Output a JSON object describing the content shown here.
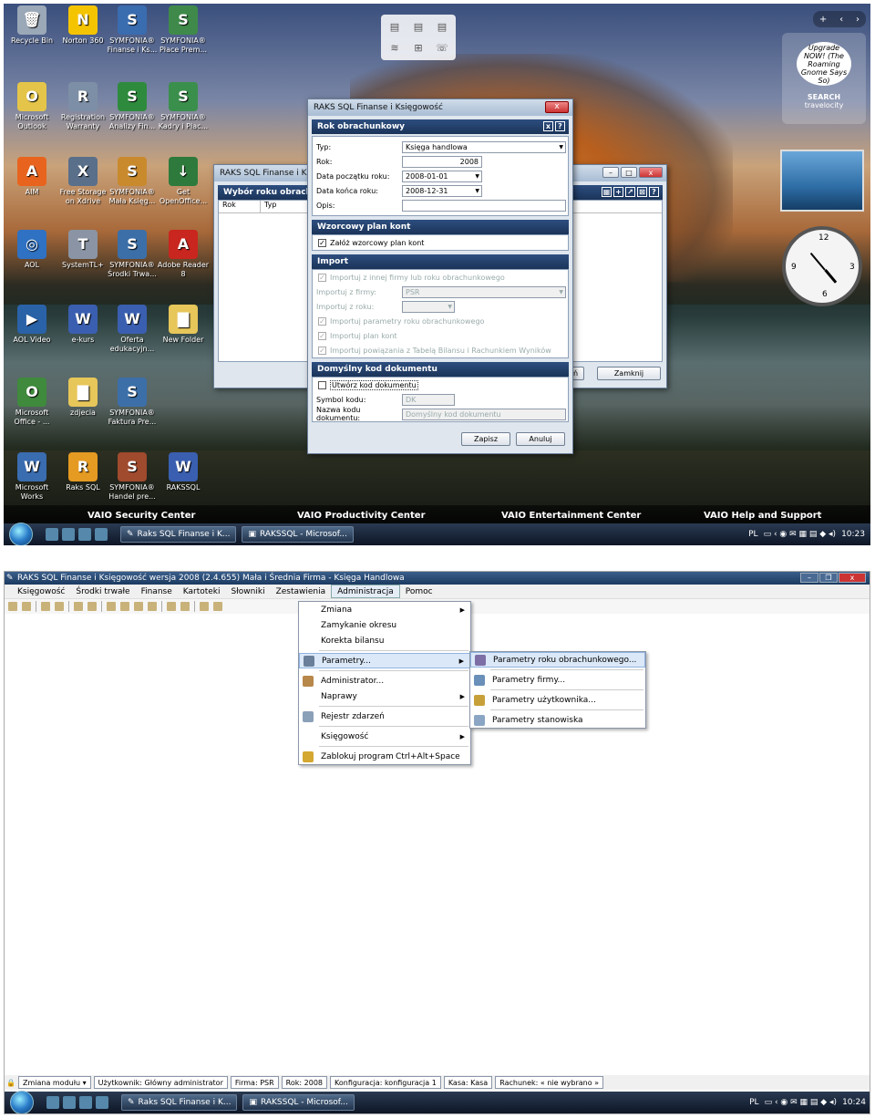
{
  "desktop": {
    "icons": [
      {
        "label": "Recycle Bin",
        "color": "#9aa8b8",
        "glyph": "🗑"
      },
      {
        "label": "Norton 360",
        "color": "#f5c400",
        "glyph": "N"
      },
      {
        "label": "SYMFONIA® Finanse i Ks...",
        "color": "#3a6cb0",
        "glyph": "S"
      },
      {
        "label": "SYMFONIA® Płace Prem...",
        "color": "#3f8a4a",
        "glyph": "S"
      },
      {
        "label": "Microsoft Outlook",
        "color": "#e4c54a",
        "glyph": "O"
      },
      {
        "label": "Registration Warranty",
        "color": "#7d8fa6",
        "glyph": "R"
      },
      {
        "label": "SYMFONIA® Analizy Fin...",
        "color": "#2e8b3e",
        "glyph": "S"
      },
      {
        "label": "SYMFONIA® Kadry i Płac...",
        "color": "#3b8f4c",
        "glyph": "S"
      },
      {
        "label": "AIM",
        "color": "#e8641e",
        "glyph": "A"
      },
      {
        "label": "Free Storage on Xdrive",
        "color": "#5a6f8a",
        "glyph": "X"
      },
      {
        "label": "SYMFONIA® Mała Księg...",
        "color": "#c98a2e",
        "glyph": "S"
      },
      {
        "label": "Get OpenOffice...",
        "color": "#2e7a3c",
        "glyph": "↓"
      },
      {
        "label": "AOL",
        "color": "#2f71c2",
        "glyph": "◎"
      },
      {
        "label": "SystemTL+",
        "color": "#8a94a4",
        "glyph": "T"
      },
      {
        "label": "SYMFONIA® Środki Trwa...",
        "color": "#3c6fa8",
        "glyph": "S"
      },
      {
        "label": "Adobe Reader 8",
        "color": "#c8261e",
        "glyph": "A"
      },
      {
        "label": "AOL Video",
        "color": "#2a62a8",
        "glyph": "▶"
      },
      {
        "label": "e-kurs",
        "color": "#3a5fb0",
        "glyph": "W"
      },
      {
        "label": "Oferta edukacyjn...",
        "color": "#3a5fb0",
        "glyph": "W"
      },
      {
        "label": "New Folder",
        "color": "#e7c65a",
        "glyph": "▇"
      },
      {
        "label": "Microsoft Office - ...",
        "color": "#3f8a3c",
        "glyph": "O"
      },
      {
        "label": "zdjecia",
        "color": "#e7c65a",
        "glyph": "▇"
      },
      {
        "label": "SYMFONIA® Faktura Pre...",
        "color": "#3c6fa8",
        "glyph": "S"
      },
      {
        "label": "Microsoft Works",
        "color": "#3a6cb0",
        "glyph": "W"
      },
      {
        "label": "Raks SQL",
        "color": "#e59a22",
        "glyph": "R"
      },
      {
        "label": "SYMFONIA® Handel pre...",
        "color": "#a04a2e",
        "glyph": "S"
      },
      {
        "label": "RAKSSQL",
        "color": "#3a5fb0",
        "glyph": "W"
      }
    ],
    "gadget_ad": {
      "text": "Upgrade NOW! (The Roaming Gnome Says So)",
      "search": "SEARCH",
      "brand": "travelocity"
    },
    "vaio": [
      "VAIO Security Center",
      "VAIO Productivity Center",
      "VAIO Entertainment Center",
      "VAIO Help and Support"
    ],
    "back_window": {
      "title": "RAKS SQL Finanse i K...",
      "panel_title": "Wybór roku obrachunkowego",
      "col1": "Rok",
      "col2": "Typ",
      "btn_partial": "Usuń",
      "close_btn": "Zamknij"
    },
    "dialog": {
      "title": "RAKS SQL Finanse i Księgowość",
      "header": "Rok obrachunkowy",
      "typ_label": "Typ:",
      "typ_value": "Księga handlowa",
      "rok_label": "Rok:",
      "rok_value": "2008",
      "start_label": "Data początku roku:",
      "start_value": "2008-01-01",
      "end_label": "Data końca roku:",
      "end_value": "2008-12-31",
      "opis_label": "Opis:",
      "plan_header": "Wzorcowy plan kont",
      "plan_chk": "Załóż wzorcowy plan kont",
      "import_header": "Import",
      "imp_chk": "Importuj z innej firmy lub roku obrachunkowego",
      "imp_firm_label": "Importuj z firmy:",
      "imp_firm_value": "PSR",
      "imp_year_label": "Importuj z roku:",
      "imp_params": "Importuj parametry roku obrachunkowego",
      "imp_plan": "Importuj plan kont",
      "imp_links": "Importuj powiązania z Tabelą Bilansu i Rachunkiem Wyników",
      "doc_header": "Domyślny kod dokumentu",
      "doc_chk": "Utwórz kod dokumentu",
      "sym_label": "Symbol kodu:",
      "sym_value": "DK",
      "name_label": "Nazwa kodu dokumentu:",
      "name_value": "Domyślny kod dokumentu",
      "save": "Zapisz",
      "cancel": "Anuluj"
    },
    "taskbar": {
      "task1": "Raks SQL Finanse i K...",
      "task2": "RAKSSQL - Microsof...",
      "lang": "PL",
      "time": "10:23"
    }
  },
  "app": {
    "title": "RAKS SQL Finanse i Księgowość wersja 2008 (2.4.655) Mała i Średnia Firma - Księga Handlowa",
    "menu": [
      "Księgowość",
      "Środki trwałe",
      "Finanse",
      "Kartoteki",
      "Słowniki",
      "Zestawienia",
      "Administracja",
      "Pomoc"
    ],
    "admin_menu": [
      {
        "label": "Zmiana",
        "submenu": true
      },
      {
        "label": "Zamykanie okresu"
      },
      {
        "label": "Korekta bilansu"
      },
      {
        "label": "Parametry...",
        "submenu": true,
        "highlight": true
      },
      {
        "label": "Administrator..."
      },
      {
        "label": "Naprawy",
        "submenu": true
      },
      {
        "label": "Rejestr zdarzeń"
      },
      {
        "label": "Księgowość",
        "submenu": true
      },
      {
        "label": "Zablokuj program",
        "shortcut": "Ctrl+Alt+Space"
      }
    ],
    "params_menu": [
      "Parametry roku obrachunkowego...",
      "Parametry firmy...",
      "Parametry użytkownika...",
      "Parametry stanowiska"
    ],
    "status": [
      "Zmiana modułu",
      "Użytkownik: Główny administrator",
      "Firma: PSR",
      "Rok: 2008",
      "Konfiguracja: konfiguracja 1",
      "Kasa: Kasa",
      "Rachunek: « nie wybrano »"
    ],
    "taskbar": {
      "task1": "Raks SQL Finanse i K...",
      "task2": "RAKSSQL - Microsof...",
      "lang": "PL",
      "time": "10:24"
    }
  }
}
